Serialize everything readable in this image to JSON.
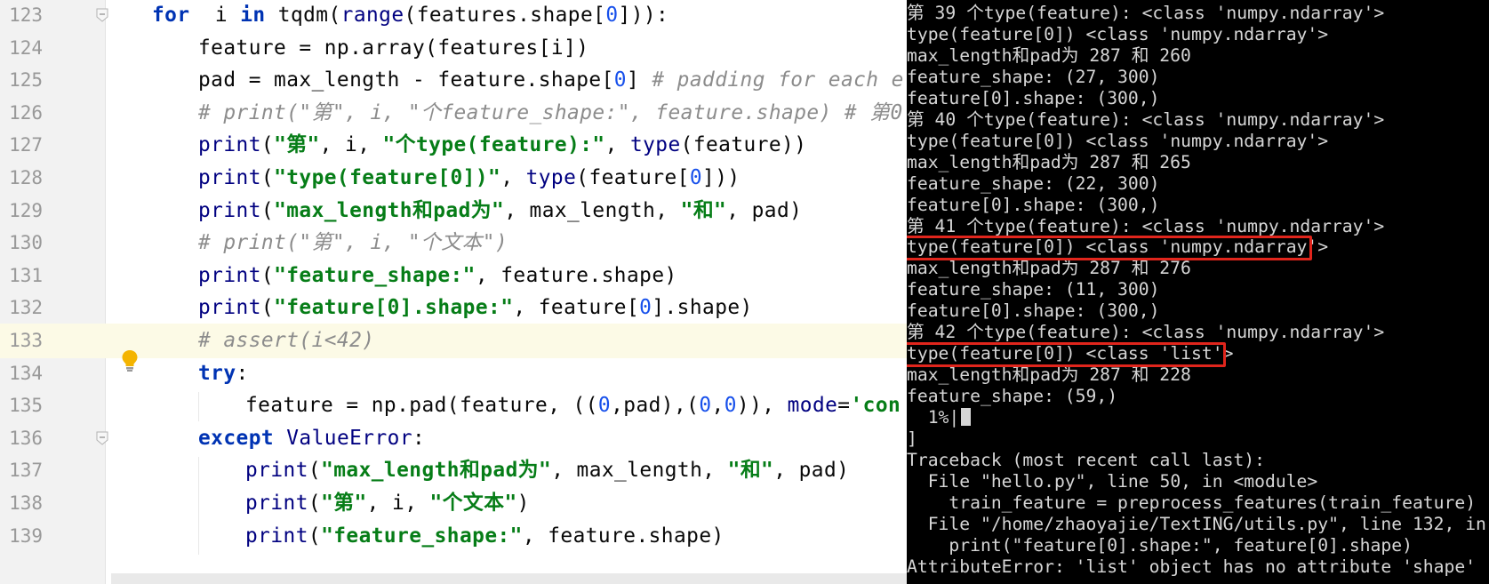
{
  "editor": {
    "lines": [
      {
        "n": "123",
        "indent": 0,
        "fold": true,
        "current": false,
        "tokens": [
          [
            "kw",
            "for"
          ],
          [
            "",
            "  i "
          ],
          [
            "kw",
            "in"
          ],
          [
            "",
            " tqdm("
          ],
          [
            "bi",
            "range"
          ],
          [
            "",
            "(features.shape["
          ],
          [
            "num",
            "0"
          ],
          [
            "",
            "])):"
          ]
        ]
      },
      {
        "n": "124",
        "indent": 1,
        "fold": false,
        "current": false,
        "tokens": [
          [
            "",
            "feature = np.array(features[i])"
          ]
        ]
      },
      {
        "n": "125",
        "indent": 1,
        "fold": false,
        "current": false,
        "tokens": [
          [
            "",
            "pad = max_length - feature.shape["
          ],
          [
            "num",
            "0"
          ],
          [
            "",
            "] "
          ],
          [
            "cmt",
            "# padding for each e"
          ]
        ]
      },
      {
        "n": "126",
        "indent": 1,
        "fold": false,
        "current": false,
        "tokens": [
          [
            "cmt",
            "# print(\"第\", i, \"个feature_shape:\", feature.shape) # 第0"
          ]
        ]
      },
      {
        "n": "127",
        "indent": 1,
        "fold": false,
        "current": false,
        "tokens": [
          [
            "bi",
            "print"
          ],
          [
            "",
            "("
          ],
          [
            "str",
            "\"第\""
          ],
          [
            "",
            ", i, "
          ],
          [
            "str",
            "\"个type(feature):\""
          ],
          [
            "",
            ", "
          ],
          [
            "bi",
            "type"
          ],
          [
            "",
            "(feature))"
          ]
        ]
      },
      {
        "n": "128",
        "indent": 1,
        "fold": false,
        "current": false,
        "tokens": [
          [
            "bi",
            "print"
          ],
          [
            "",
            "("
          ],
          [
            "str",
            "\"type(feature[0])\""
          ],
          [
            "",
            ", "
          ],
          [
            "bi",
            "type"
          ],
          [
            "",
            "(feature["
          ],
          [
            "num",
            "0"
          ],
          [
            "",
            "]))"
          ]
        ]
      },
      {
        "n": "129",
        "indent": 1,
        "fold": false,
        "current": false,
        "tokens": [
          [
            "bi",
            "print"
          ],
          [
            "",
            "("
          ],
          [
            "str",
            "\"max_length和pad为\""
          ],
          [
            "",
            ", max_length, "
          ],
          [
            "str",
            "\"和\""
          ],
          [
            "",
            ", pad)"
          ]
        ]
      },
      {
        "n": "130",
        "indent": 1,
        "fold": false,
        "current": false,
        "tokens": [
          [
            "cmt",
            "# print(\"第\", i, \"个文本\")"
          ]
        ]
      },
      {
        "n": "131",
        "indent": 1,
        "fold": false,
        "current": false,
        "tokens": [
          [
            "bi",
            "print"
          ],
          [
            "",
            "("
          ],
          [
            "str",
            "\"feature_shape:\""
          ],
          [
            "",
            ", feature.shape)"
          ]
        ]
      },
      {
        "n": "132",
        "indent": 1,
        "fold": false,
        "current": false,
        "tokens": [
          [
            "bi",
            "print"
          ],
          [
            "",
            "("
          ],
          [
            "str",
            "\"feature[0].shape:\""
          ],
          [
            "",
            ", feature["
          ],
          [
            "num",
            "0"
          ],
          [
            "",
            "].shape)"
          ]
        ]
      },
      {
        "n": "133",
        "indent": 1,
        "fold": false,
        "current": true,
        "tokens": [
          [
            "cmt",
            "# assert(i<42)"
          ]
        ]
      },
      {
        "n": "134",
        "indent": 1,
        "fold": false,
        "current": false,
        "tokens": [
          [
            "kw",
            "try"
          ],
          [
            "",
            ":"
          ]
        ]
      },
      {
        "n": "135",
        "indent": 2,
        "fold": false,
        "current": false,
        "tokens": [
          [
            "",
            "feature = np.pad(feature, (("
          ],
          [
            "num",
            "0"
          ],
          [
            "",
            ",pad),("
          ],
          [
            "num",
            "0"
          ],
          [
            "",
            ","
          ],
          [
            "num",
            "0"
          ],
          [
            "",
            ")), "
          ],
          [
            "bi",
            "mode"
          ],
          [
            "",
            "="
          ],
          [
            "str",
            "'con"
          ]
        ]
      },
      {
        "n": "136",
        "indent": 1,
        "fold": true,
        "current": false,
        "tokens": [
          [
            "kw",
            "except"
          ],
          [
            "",
            " "
          ],
          [
            "bi",
            "ValueError"
          ],
          [
            "",
            ":"
          ]
        ]
      },
      {
        "n": "137",
        "indent": 2,
        "fold": false,
        "current": false,
        "tokens": [
          [
            "bi",
            "print"
          ],
          [
            "",
            "("
          ],
          [
            "str",
            "\"max_length和pad为\""
          ],
          [
            "",
            ", max_length, "
          ],
          [
            "str",
            "\"和\""
          ],
          [
            "",
            ", pad)"
          ]
        ]
      },
      {
        "n": "138",
        "indent": 2,
        "fold": false,
        "current": false,
        "tokens": [
          [
            "bi",
            "print"
          ],
          [
            "",
            "("
          ],
          [
            "str",
            "\"第\""
          ],
          [
            "",
            ", i, "
          ],
          [
            "str",
            "\"个文本\""
          ],
          [
            "",
            ")"
          ]
        ]
      },
      {
        "n": "139",
        "indent": 2,
        "fold": false,
        "current": false,
        "tokens": [
          [
            "bi",
            "print"
          ],
          [
            "",
            "("
          ],
          [
            "str",
            "\"feature_shape:\""
          ],
          [
            "",
            ", feature.shape)"
          ]
        ]
      }
    ]
  },
  "terminal": {
    "lines": [
      "第 39 个type(feature): <class 'numpy.ndarray'>",
      "type(feature[0]) <class 'numpy.ndarray'>",
      "max_length和pad为 287 和 260",
      "feature_shape: (27, 300)",
      "feature[0].shape: (300,)",
      "第 40 个type(feature): <class 'numpy.ndarray'>",
      "type(feature[0]) <class 'numpy.ndarray'>",
      "max_length和pad为 287 和 265",
      "feature_shape: (22, 300)",
      "feature[0].shape: (300,)",
      "第 41 个type(feature): <class 'numpy.ndarray'>",
      "type(feature[0]) <class 'numpy.ndarray'>",
      "max_length和pad为 287 和 276",
      "feature_shape: (11, 300)",
      "feature[0].shape: (300,)",
      "第 42 个type(feature): <class 'numpy.ndarray'>",
      "type(feature[0]) <class 'list'>",
      "max_length和pad为 287 和 228",
      "feature_shape: (59,)",
      "  1%|",
      "]",
      "Traceback (most recent call last):",
      "  File \"hello.py\", line 50, in <module>",
      "    train_feature = preprocess_features(train_feature)",
      "  File \"/home/zhaoyajie/TextING/utils.py\", line 132, in",
      "    print(\"feature[0].shape:\", feature[0].shape)",
      "AttributeError: 'list' object has no attribute 'shape'"
    ],
    "highlighted": [
      11,
      16
    ],
    "cursor_line": 19
  },
  "colors": {
    "highlight_box": "#e0251c",
    "terminal_bg": "#000000",
    "terminal_fg": "#d6d6d6"
  }
}
